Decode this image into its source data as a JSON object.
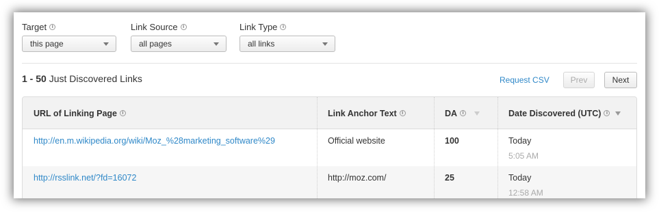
{
  "filters": [
    {
      "label": "Target",
      "value": "this page"
    },
    {
      "label": "Link Source",
      "value": "all pages"
    },
    {
      "label": "Link Type",
      "value": "all links"
    }
  ],
  "results": {
    "range": "1 - 50",
    "title": "Just Discovered Links",
    "csv_label": "Request CSV",
    "prev_label": "Prev",
    "next_label": "Next"
  },
  "table": {
    "headers": {
      "url": "URL of Linking Page",
      "anchor": "Link Anchor Text",
      "da": "DA",
      "date": "Date Discovered (UTC)"
    },
    "rows": [
      {
        "url": "http://en.m.wikipedia.org/wiki/Moz_%28marketing_software%29",
        "anchor": "Official website",
        "da": "100",
        "date": "Today",
        "time": "5:05 AM"
      },
      {
        "url": "http://rsslink.net/?fd=16072",
        "anchor": "http://moz.com/",
        "da": "25",
        "date": "Today",
        "time": "12:58 AM"
      }
    ]
  },
  "icons": {
    "info": "info-icon",
    "select_caret": "chevron-down-icon",
    "sort": "sort-desc-icon"
  },
  "colors": {
    "link": "#2f88c8",
    "header_bg": "#f2f2f2",
    "alt_row_bg": "#f6f6f6"
  }
}
